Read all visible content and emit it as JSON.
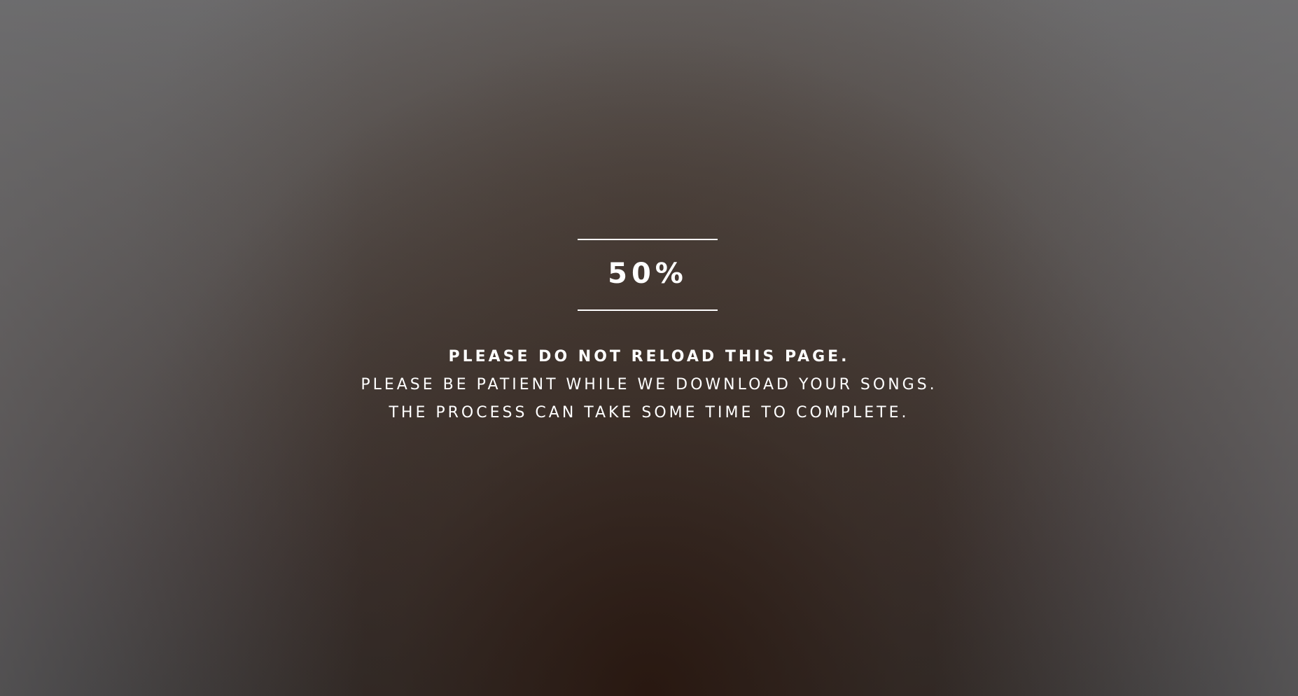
{
  "progress": {
    "value": 50,
    "label": "50%"
  },
  "message": {
    "line1": "PLEASE DO NOT RELOAD THIS PAGE.",
    "line2": "PLEASE BE PATIENT WHILE WE DOWNLOAD YOUR SONGS.",
    "line3": "THE PROCESS CAN TAKE SOME TIME TO COMPLETE."
  },
  "colors": {
    "text": "#ffffff",
    "background_dark": "#2a1a12",
    "background_light": "#6b6a6b"
  }
}
